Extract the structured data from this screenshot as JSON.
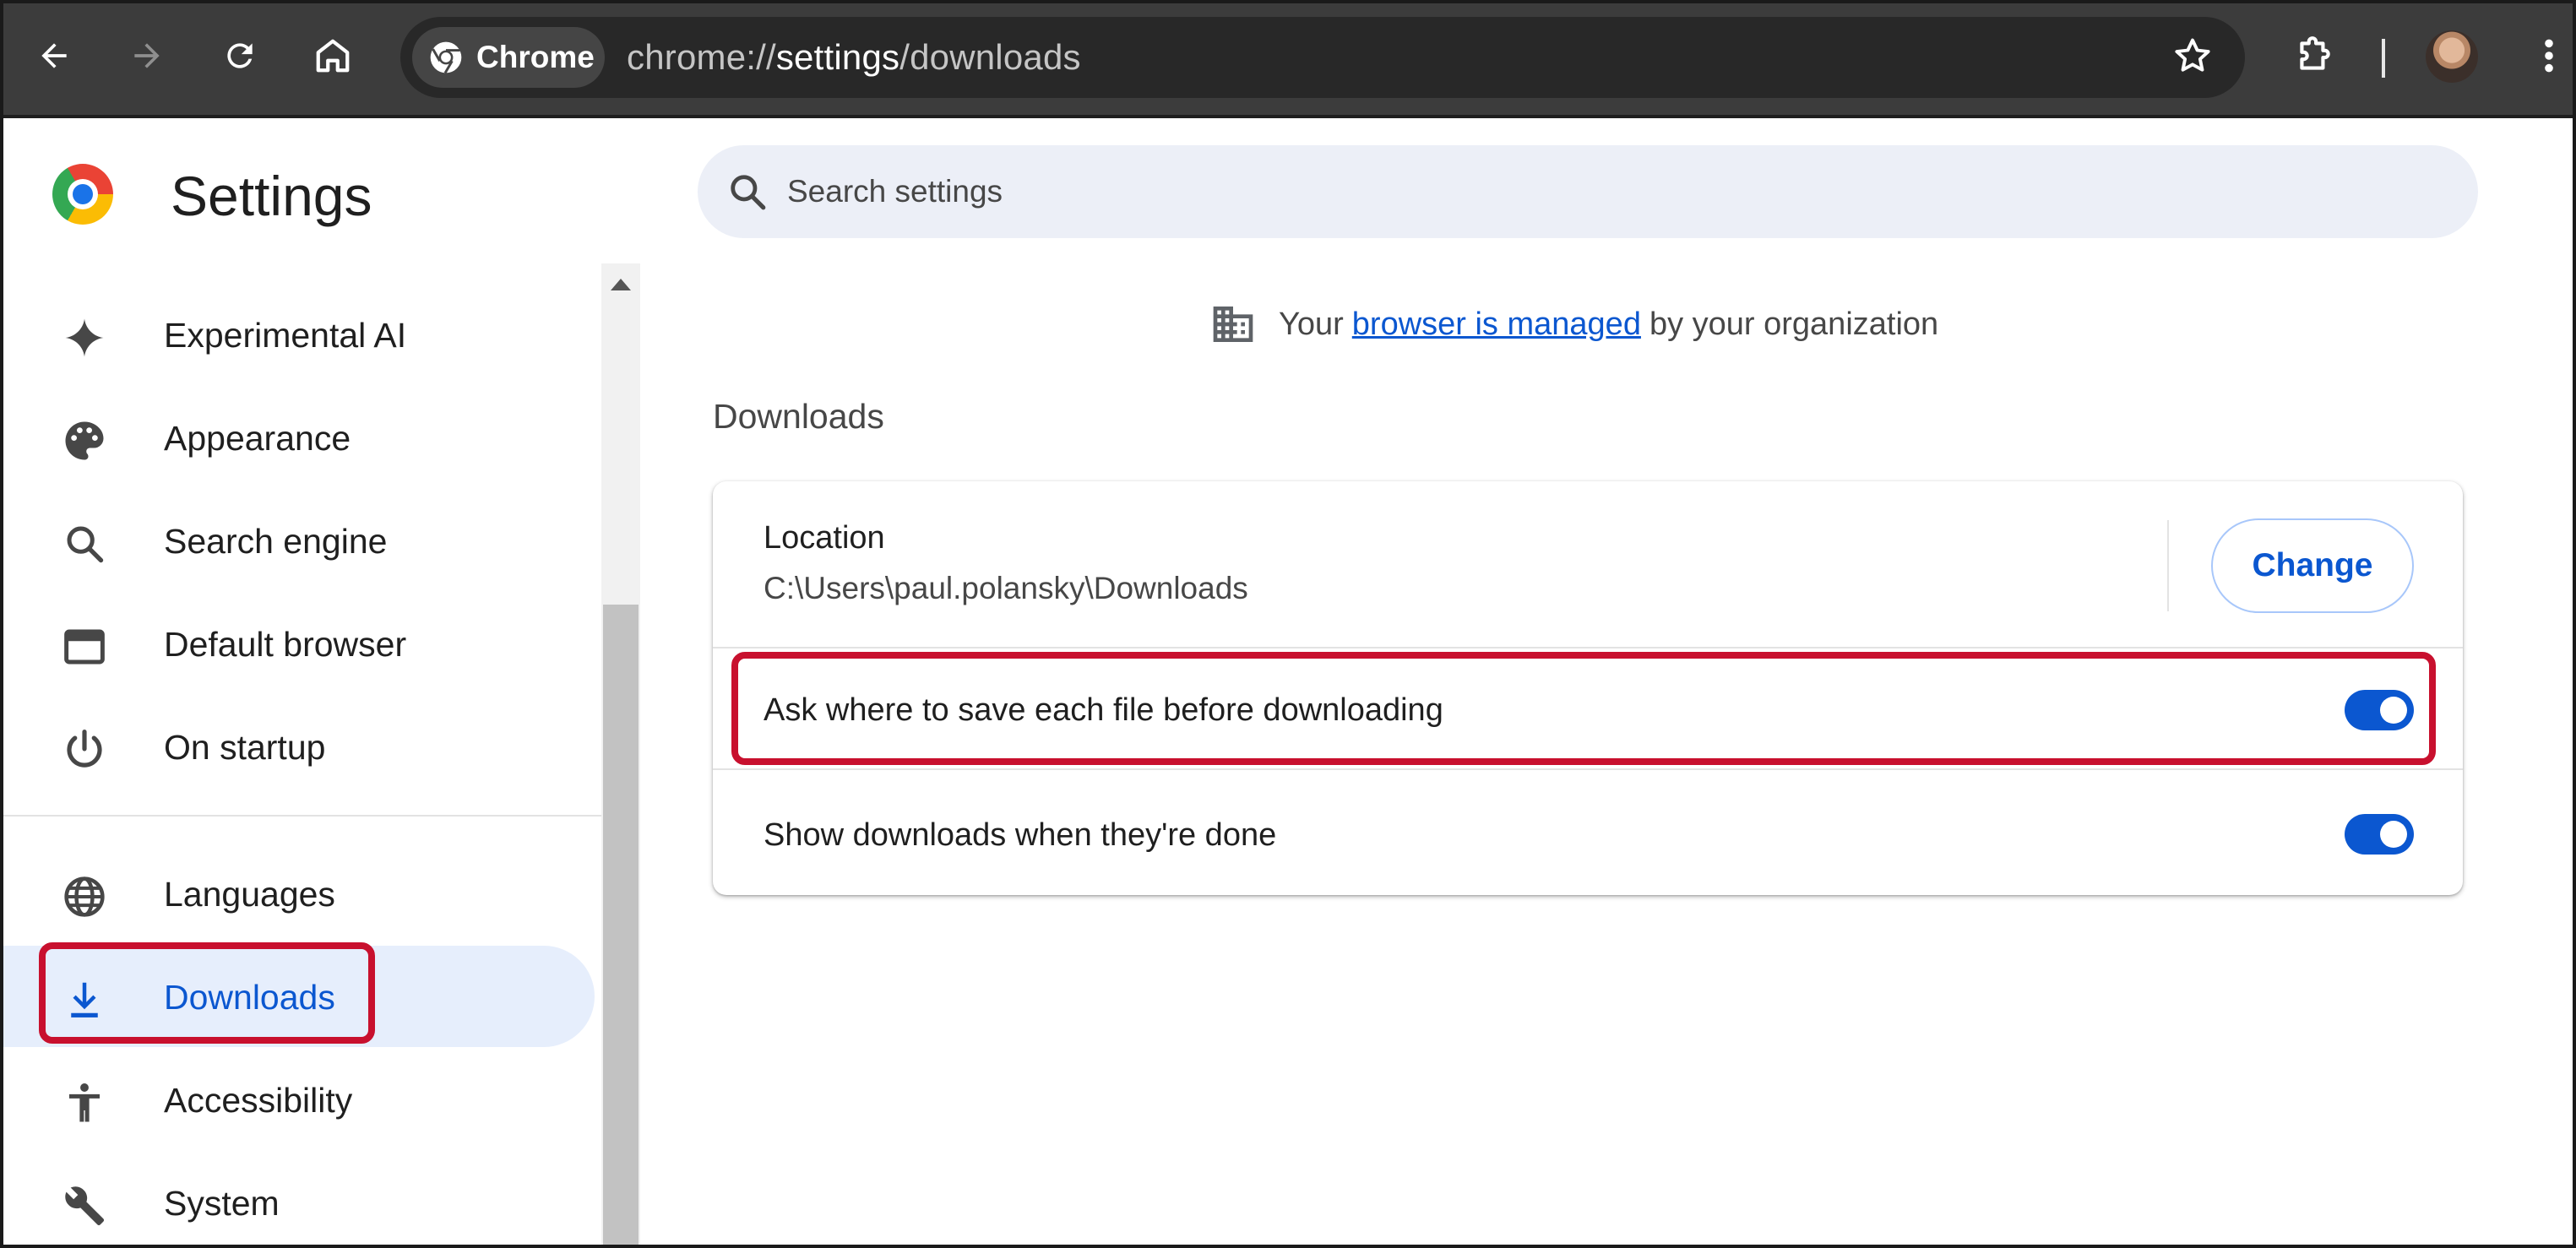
{
  "browser": {
    "chip_label": "Chrome",
    "url": {
      "scheme": "chrome://",
      "host": "settings",
      "path": "/downloads"
    }
  },
  "page": {
    "title": "Settings",
    "search_placeholder": "Search settings"
  },
  "sidebar": {
    "items": [
      {
        "label": "Experimental AI",
        "icon": "sparkle-icon"
      },
      {
        "label": "Appearance",
        "icon": "palette-icon"
      },
      {
        "label": "Search engine",
        "icon": "search-icon"
      },
      {
        "label": "Default browser",
        "icon": "browser-window-icon"
      },
      {
        "label": "On startup",
        "icon": "power-icon"
      },
      {
        "label": "Languages",
        "icon": "globe-icon"
      },
      {
        "label": "Downloads",
        "icon": "download-icon",
        "selected": true
      },
      {
        "label": "Accessibility",
        "icon": "accessibility-icon"
      },
      {
        "label": "System",
        "icon": "wrench-icon"
      }
    ]
  },
  "managed_notice": {
    "prefix": "Your",
    "link": "browser is managed",
    "suffix": "by your organization"
  },
  "downloads": {
    "section_title": "Downloads",
    "location_label": "Location",
    "location_path": "C:\\Users\\paul.polansky\\Downloads",
    "change_button": "Change",
    "ask_where_label": "Ask where to save each file before downloading",
    "ask_where_enabled": true,
    "show_downloads_label": "Show downloads when they're done",
    "show_downloads_enabled": true
  },
  "colors": {
    "accent": "#0b57d0",
    "highlight": "#c8102e",
    "toolbar": "#3c3c3c",
    "selected_bg": "#e6eefc"
  }
}
